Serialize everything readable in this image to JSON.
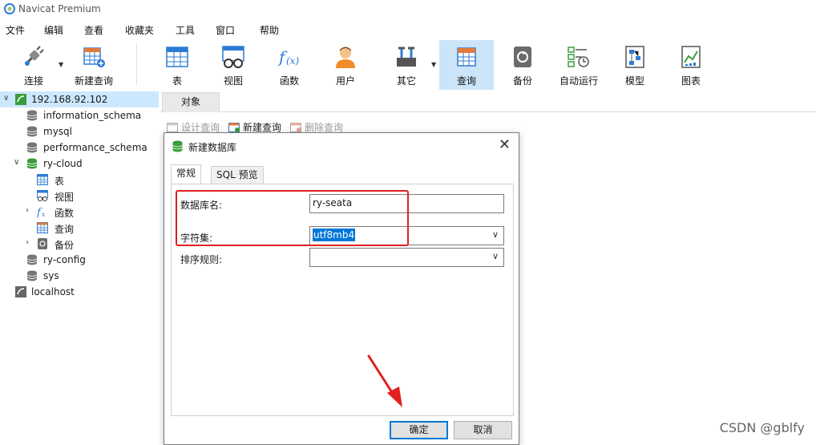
{
  "app": {
    "title": "Navicat Premium"
  },
  "menu": [
    "文件",
    "编辑",
    "查看",
    "收藏夹",
    "工具",
    "窗口",
    "帮助"
  ],
  "toolbar": {
    "items": [
      {
        "label": "连接",
        "icon": "connection-plug-icon"
      },
      {
        "label": "新建查询",
        "icon": "new-query-icon"
      },
      {
        "label": "表",
        "icon": "table-icon"
      },
      {
        "label": "视图",
        "icon": "view-icon"
      },
      {
        "label": "函数",
        "icon": "function-icon"
      },
      {
        "label": "用户",
        "icon": "user-icon"
      },
      {
        "label": "其它",
        "icon": "tools-icon"
      },
      {
        "label": "查询",
        "icon": "query-icon"
      },
      {
        "label": "备份",
        "icon": "backup-icon"
      },
      {
        "label": "自动运行",
        "icon": "schedule-icon"
      },
      {
        "label": "模型",
        "icon": "model-icon"
      },
      {
        "label": "图表",
        "icon": "chart-icon"
      }
    ],
    "active": "查询"
  },
  "tree": {
    "nodes": [
      {
        "label": "192.168.92.102",
        "icon": "connection-icon"
      },
      {
        "label": "information_schema",
        "icon": "database-icon"
      },
      {
        "label": "mysql",
        "icon": "database-icon"
      },
      {
        "label": "performance_schema",
        "icon": "database-icon"
      },
      {
        "label": "ry-cloud",
        "icon": "database-open-icon"
      },
      {
        "label": "表",
        "icon": "table-icon"
      },
      {
        "label": "视图",
        "icon": "view-icon"
      },
      {
        "label": "函数",
        "icon": "function-icon"
      },
      {
        "label": "查询",
        "icon": "query-icon"
      },
      {
        "label": "备份",
        "icon": "backup-icon"
      },
      {
        "label": "ry-config",
        "icon": "database-icon"
      },
      {
        "label": "sys",
        "icon": "database-icon"
      },
      {
        "label": "localhost",
        "icon": "connection-icon"
      }
    ]
  },
  "objects_tab": {
    "label": "对象"
  },
  "object_toolbar": {
    "design_query": "设计查询",
    "new_query": "新建查询",
    "delete_query": "删除查询"
  },
  "dialog": {
    "title": "新建数据库",
    "tabs": [
      "常规",
      "SQL 预览"
    ],
    "fields": {
      "db_name_label": "数据库名:",
      "db_name_value": "ry-seata",
      "charset_label": "字符集:",
      "charset_value": "utf8mb4",
      "collation_label": "排序规则:",
      "collation_value": ""
    },
    "ok_label": "确定",
    "cancel_label": "取消"
  },
  "watermark": "CSDN @gblfy",
  "colors": {
    "highlight": "#e02020",
    "selection": "#0078d7",
    "active_tool": "#cce4f7"
  }
}
